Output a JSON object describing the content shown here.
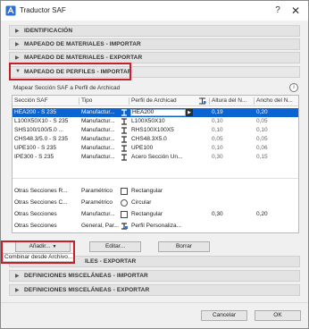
{
  "window": {
    "title": "Traductor SAF",
    "help_label": "?",
    "close_label": "✕"
  },
  "sections": {
    "identificacion": "IDENTIFICACIÓN",
    "mat_import": "MAPEADO DE MATERIALES - IMPORTAR",
    "mat_export": "MAPEADO DE MATERIALES - EXPORTAR",
    "perf_import": "MAPEADO DE PERFILES - IMPORTAR",
    "perf_export": "MAPEADO DE PERFILES - EXPORTAR",
    "perf_export_visible": "ILES - EXPORTAR",
    "misc_import": "DEFINICIONES MISCELÁNEAS - IMPORTAR",
    "misc_export": "DEFINICIONES MISCELÁNEAS - EXPORTAR"
  },
  "profiles": {
    "subheading": "Mapear Sección SAF a Perfil de Archicad",
    "info_label": "i",
    "columns": [
      "Sección SAF",
      "Tipo",
      "Perfil de Archicad",
      "Altura del N...",
      "Ancho del N..."
    ],
    "rows": [
      {
        "saf": "HEA200 - S 235",
        "tipo": "Manufactur...",
        "perfil": "HEA200",
        "altura": "0,19",
        "ancho": "0,20",
        "selected": true
      },
      {
        "saf": "L100X50X10 - S 235",
        "tipo": "Manufactur...",
        "perfil": "L100X50X10",
        "altura": "0,10",
        "ancho": "0,05"
      },
      {
        "saf": "SHS100/100/5.0 ...",
        "tipo": "Manufactur...",
        "perfil": "RHS100X100X5",
        "altura": "0,10",
        "ancho": "0,10"
      },
      {
        "saf": "CHS48.3/5.0 - S 235",
        "tipo": "Manufactur...",
        "perfil": "CHS48.3X5.0",
        "altura": "0,05",
        "ancho": "0,05"
      },
      {
        "saf": "UPE100 - S 235",
        "tipo": "Manufactur...",
        "perfil": "UPE100",
        "altura": "0,10",
        "ancho": "0,06"
      },
      {
        "saf": "IPE300 - S 235",
        "tipo": "Manufactur...",
        "perfil": "Acero Sección Un...",
        "altura": "0,30",
        "ancho": "0,15"
      }
    ],
    "other_rows": [
      {
        "saf": "Otras Secciones R...",
        "tipo": "Paramétrico",
        "perfil": "Rectangular",
        "altura": "",
        "ancho": ""
      },
      {
        "saf": "Otras Secciones C...",
        "tipo": "Paramétrico",
        "perfil": "Circular",
        "altura": "",
        "ancho": ""
      },
      {
        "saf": "Otras Secciones",
        "tipo": "Manufactur...",
        "perfil": "Rectangular",
        "altura": "0,30",
        "ancho": "0,20"
      },
      {
        "saf": "Otras Secciones",
        "tipo": "General, Par...",
        "perfil": "Perfil Personaliza...",
        "altura": "",
        "ancho": ""
      }
    ]
  },
  "buttons": {
    "add": "Añadir...",
    "add_arrow": "▼",
    "add_option": "Combinar desde Archivo...",
    "edit": "Editar...",
    "delete": "Borrar",
    "cancel": "Cancelar",
    "ok": "OK"
  },
  "colors": {
    "selection": "#0a64d2",
    "highlight": "#c8202a"
  }
}
